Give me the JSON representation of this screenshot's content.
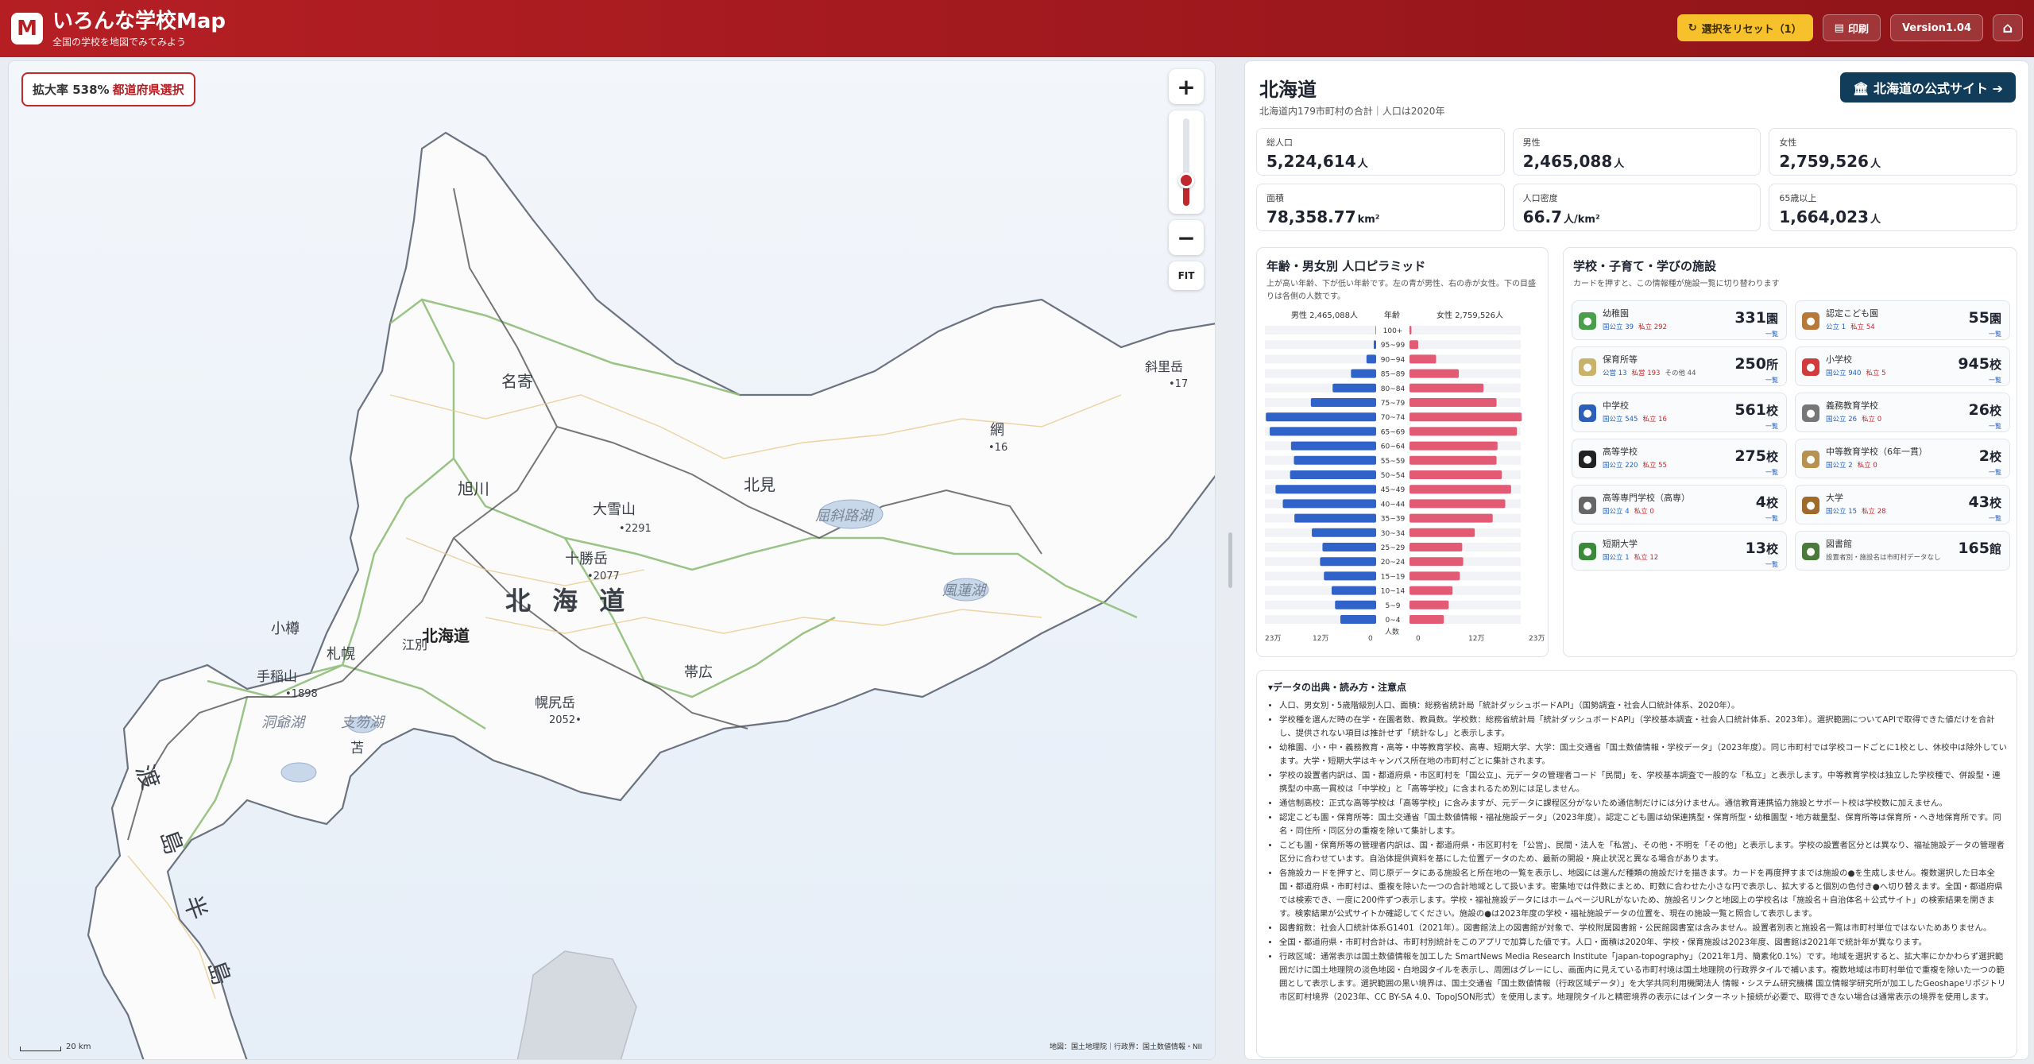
{
  "header": {
    "logo_letter": "M",
    "title": "いろんな学校Map",
    "subtitle": "全国の学校を地図でみてみよう",
    "reset_label": "選択をリセット（1）",
    "print_label": "印刷",
    "version_label": "Version1.04",
    "home_icon": "home-icon"
  },
  "map": {
    "zoom_text": "拡大率 538%",
    "mode_text": "都道府県選択",
    "zoom_in": "+",
    "zoom_out": "−",
    "fit_label": "FIT",
    "zoom_level_fraction": 0.2,
    "scale_label": "20 km",
    "attribution": "地図：国土地理院｜行政界：国土数値情報・NII",
    "labels": {
      "prefecture": "北 海 道",
      "hokkaido_pin": "北海道",
      "nayoro": "名寄",
      "asahikawa": "旭川",
      "kitami": "北見",
      "daisetsu": "大雪山",
      "daisetsu_elev": "•2291",
      "tokachi": "十勝岳",
      "tokachi_elev": "•2077",
      "kussharo": "屈斜路湖",
      "furen": "風蓮湖",
      "otaru": "小樽",
      "sapporo": "札幌",
      "ebetsu": "江別",
      "obihiro": "帯広",
      "teine": "手稲山",
      "teine_elev": "•1898",
      "toya": "洞爺湖",
      "shikotsu": "支笏湖",
      "tomakomai": "苫",
      "horoshiri": "幌尻岳",
      "horoshiri_elev": "2052•",
      "oshima": "渡 島 半 島",
      "abashiri_frag": "網",
      "abashiri_num": "•16",
      "shiretoko_frag": "斜里岳",
      "shiretoko_num": "•17"
    }
  },
  "panel": {
    "pref_name": "北海道",
    "pref_sub": "北海道内179市町村の合計｜人口は2020年",
    "official_label": "🏛 北海道の公式サイト ➔",
    "stats": [
      {
        "label": "総人口",
        "value": "5,224,614",
        "unit": "人"
      },
      {
        "label": "男性",
        "value": "2,465,088",
        "unit": "人"
      },
      {
        "label": "女性",
        "value": "2,759,526",
        "unit": "人"
      },
      {
        "label": "面積",
        "value": "78,358.77",
        "unit": "km²"
      },
      {
        "label": "人口密度",
        "value": "66.7",
        "unit": "人/km²"
      },
      {
        "label": "65歳以上",
        "value": "1,664,023",
        "unit": "人"
      }
    ]
  },
  "pyramid": {
    "title": "年齢・男女別 人口ピラミッド",
    "desc": "上が高い年齢、下が低い年齢です。左の青が男性、右の赤が女性。下の目盛りは各側の人数です。",
    "male_header": "男性 2,465,088人",
    "age_header": "年齢",
    "female_header": "女性 2,759,526人",
    "axis_title": "人数",
    "ticks": [
      "23万",
      "12万",
      "0",
      "0",
      "12万",
      "23万"
    ],
    "max": 230000,
    "male_color": "#2f63c9",
    "female_color": "#e25a73"
  },
  "chart_data": {
    "type": "bar",
    "title": "年齢・男女別 人口ピラミッド",
    "categories": [
      "100+",
      "95~99",
      "90~94",
      "85~89",
      "80~84",
      "75~79",
      "70~74",
      "65~69",
      "60~64",
      "55~59",
      "50~54",
      "45~49",
      "40~44",
      "35~39",
      "30~34",
      "25~29",
      "20~24",
      "15~19",
      "10~14",
      "5~9",
      "0~4"
    ],
    "series": [
      {
        "name": "男性 2,465,088人",
        "values": [
          1000,
          5000,
          20000,
          52000,
          90000,
          135000,
          228000,
          220000,
          176000,
          170000,
          178000,
          208000,
          193000,
          169000,
          133000,
          111000,
          116000,
          108000,
          92000,
          85000,
          74000
        ]
      },
      {
        "name": "女性 2,759,526人",
        "values": [
          4000,
          18000,
          55000,
          102000,
          153000,
          180000,
          232000,
          222000,
          182000,
          180000,
          191000,
          210000,
          198000,
          172000,
          135000,
          109000,
          111000,
          104000,
          89000,
          81000,
          71000
        ]
      }
    ],
    "xlim": [
      0,
      230000
    ]
  },
  "facilities": {
    "title": "学校・子育て・学びの施設",
    "desc": "カードを押すと、この情報種が施設一覧に切り替わります",
    "link": "一覧",
    "items": [
      {
        "name": "幼稚園",
        "sub": [
          "国公立 39",
          "私立 292"
        ],
        "value": "331",
        "unit": "園",
        "icon": "sprout-icon",
        "color": "#4aa04a"
      },
      {
        "name": "認定こども園",
        "sub": [
          "公立 1",
          "私立 54"
        ],
        "value": "55",
        "unit": "園",
        "icon": "teddy-bear-icon",
        "color": "#b8783a"
      },
      {
        "name": "保育所等",
        "sub": [
          "公営 13",
          "私営 193",
          "その他 44"
        ],
        "value": "250",
        "unit": "所",
        "icon": "bottle-icon",
        "color": "#c9b36a"
      },
      {
        "name": "小学校",
        "sub": [
          "国公立 940",
          "私立 5"
        ],
        "value": "945",
        "unit": "校",
        "icon": "backpack-icon",
        "color": "#d23b3b"
      },
      {
        "name": "中学校",
        "sub": [
          "国公立 545",
          "私立 16"
        ],
        "value": "561",
        "unit": "校",
        "icon": "book-icon",
        "color": "#2c5fb8"
      },
      {
        "name": "義務教育学校",
        "sub": [
          "国公立 26",
          "私立 0"
        ],
        "value": "26",
        "unit": "校",
        "icon": "link-icon",
        "color": "#777777"
      },
      {
        "name": "高等学校",
        "sub": [
          "国公立 220",
          "私立 55"
        ],
        "value": "275",
        "unit": "校",
        "icon": "graduation-cap-icon",
        "color": "#222222"
      },
      {
        "name": "中等教育学校（6年一貫）",
        "sub": [
          "国公立 2",
          "私立 0"
        ],
        "value": "2",
        "unit": "校",
        "icon": "school-building-icon",
        "color": "#b89050"
      },
      {
        "name": "高等専門学校（高専）",
        "sub": [
          "国公立 4",
          "私立 0"
        ],
        "value": "4",
        "unit": "校",
        "icon": "gear-icon",
        "color": "#666666"
      },
      {
        "name": "大学",
        "sub": [
          "国公立 15",
          "私立 28"
        ],
        "value": "43",
        "unit": "校",
        "icon": "institution-icon",
        "color": "#a06a2a"
      },
      {
        "name": "短期大学",
        "sub": [
          "国公立 1",
          "私立 12"
        ],
        "value": "13",
        "unit": "校",
        "icon": "green-book-icon",
        "color": "#3a8a3a"
      },
      {
        "name": "図書館",
        "sub": [
          "設置者別・施設名は市町村データなし"
        ],
        "value": "165",
        "unit": "館",
        "icon": "books-icon",
        "color": "#4a7a3a"
      }
    ]
  },
  "notes": {
    "title": "▾データの出典・読み方・注意点",
    "items": [
      "人口、男女別・5歳階級別人口、面積：総務省統計局「統計ダッシュボードAPI」（国勢調査・社会人口統計体系、2020年）。",
      "学校種を選んだ時の在学・在園者数、教員数。学校数：総務省統計局「統計ダッシュボードAPI」（学校基本調査・社会人口統計体系、2023年）。選択範囲についてAPIで取得できた値だけを合計し、提供されない項目は推計せず「統計なし」と表示します。",
      "幼稚園、小・中・義務教育・高等・中等教育学校、高専、短期大学、大学：国土交通省「国土数値情報・学校データ」（2023年度）。同じ市町村では学校コードごとに1校とし、休校中は除外しています。大学・短期大学はキャンパス所在地の市町村ごとに集計されます。",
      "学校の設置者内訳は、国・都道府県・市区町村を「国公立」、元データの管理者コード「民間」を、学校基本調査で一般的な「私立」と表示します。中等教育学校は独立した学校種で、併設型・連携型の中高一貫校は「中学校」と「高等学校」に含まれるため別には足しません。",
      "通信制高校：正式な高等学校は「高等学校」に含みますが、元データに課程区分がないため通信制だけには分けません。通信教育連携協力施設とサポート校は学校数に加えません。",
      "認定こども園・保育所等：国土交通省「国土数値情報・福祉施設データ」（2023年度）。認定こども園は幼保連携型・保育所型・幼稚園型・地方裁量型、保育所等は保育所・へき地保育所です。同名・同住所・同区分の重複を除いて集計します。",
      "こども園・保育所等の管理者内訳は、国・都道府県・市区町村を「公営」、民間・法人を「私営」、その他・不明を「その他」と表示します。学校の設置者区分とは異なり、福祉施設データの管理者区分に合わせています。自治体提供資料を基にした位置データのため、最新の開設・廃止状況と異なる場合があります。",
      "各施設カードを押すと、同じ原データにある施設名と所在地の一覧を表示し、地図には選んだ種類の施設だけを描きます。カードを再度押すまでは施設の●を生成しません。複数選択した日本全国・都道府県・市町村は、重複を除いた一つの合計地域として扱います。密集地では件数にまとめ、町数に合わせた小さな円で表示し、拡大すると個別の色付き●へ切り替えます。全国・都道府県では検索でき、一度に200件ずつ表示します。学校・福祉施設データにはホームページURLがないため、施設名リンクと地図上の学校名は「施設名＋自治体名＋公式サイト」の検索結果を開きます。検索結果が公式サイトか確認してください。施設の●は2023年度の学校・福祉施設データの位置を、現在の施設一覧と照合して表示します。",
      "図書館数：社会人口統計体系G1401（2021年）。図書館法上の図書館が対象で、学校附属図書館・公民館図書室は含みません。設置者別表と施設名一覧は市町村単位ではないためありません。",
      "全国・都道府県・市町村合計は、市町村別統計をこのアプリで加算した値です。人口・面積は2020年、学校・保育施設は2023年度、図書館は2021年で統計年が異なります。",
      "行政区域：通常表示は国土数値情報を加工した SmartNews Media Research Institute「japan-topography」（2021年1月、簡素化0.1%）です。地域を選択すると、拡大率にかかわらず選択範囲だけに国土地理院の淡色地図・白地図タイルを表示し、周囲はグレーにし、画面内に見えている市町村境は国土地理院の行政界タイルで補います。複数地域は市町村単位で重複を除いた一つの範囲として表示します。選択範囲の黒い境界は、国土交通省「国土数値情報（行政区域データ）」を大学共同利用機関法人 情報・システム研究機構 国立情報学研究所が加工したGeoshapeリポジトリ 市区町村境界（2023年、CC BY-SA 4.0、TopoJSON形式）を使用します。地理院タイルと精密境界の表示にはインターネット接続が必要で、取得できない場合は通常表示の境界を使用します。"
    ]
  }
}
